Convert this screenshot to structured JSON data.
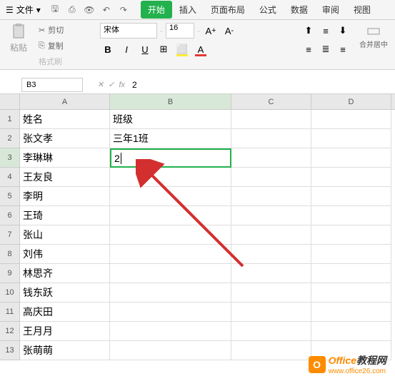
{
  "menubar": {
    "file_label": "文件",
    "tabs": [
      "开始",
      "插入",
      "页面布局",
      "公式",
      "数据",
      "审阅",
      "视图"
    ],
    "active_tab": 0
  },
  "ribbon": {
    "paste_label": "粘贴",
    "cut_label": "剪切",
    "copy_label": "复制",
    "format_painter": "格式刷",
    "font_name": "宋体",
    "font_size": "16",
    "merge_label": "合并居中"
  },
  "namebox": {
    "cell_ref": "B3",
    "fx_label": "fx",
    "formula_value": "2"
  },
  "grid": {
    "columns": [
      "A",
      "B",
      "C",
      "D"
    ],
    "active_row": 3,
    "active_col": "B",
    "rows": [
      {
        "n": 1,
        "a": "姓名",
        "b": "班级"
      },
      {
        "n": 2,
        "a": "张文孝",
        "b": "三年1班"
      },
      {
        "n": 3,
        "a": "李琳琳",
        "b": "2"
      },
      {
        "n": 4,
        "a": "王友良",
        "b": ""
      },
      {
        "n": 5,
        "a": "李明",
        "b": ""
      },
      {
        "n": 6,
        "a": "王琦",
        "b": ""
      },
      {
        "n": 7,
        "a": "张山",
        "b": ""
      },
      {
        "n": 8,
        "a": "刘伟",
        "b": ""
      },
      {
        "n": 9,
        "a": "林思齐",
        "b": ""
      },
      {
        "n": 10,
        "a": "钱东跃",
        "b": ""
      },
      {
        "n": 11,
        "a": "高庆田",
        "b": ""
      },
      {
        "n": 12,
        "a": "王月月",
        "b": ""
      },
      {
        "n": 13,
        "a": "张萌萌",
        "b": ""
      }
    ]
  },
  "watermark": {
    "title_prefix": "Office",
    "title_suffix": "教程网",
    "url": "www.office26.com"
  }
}
